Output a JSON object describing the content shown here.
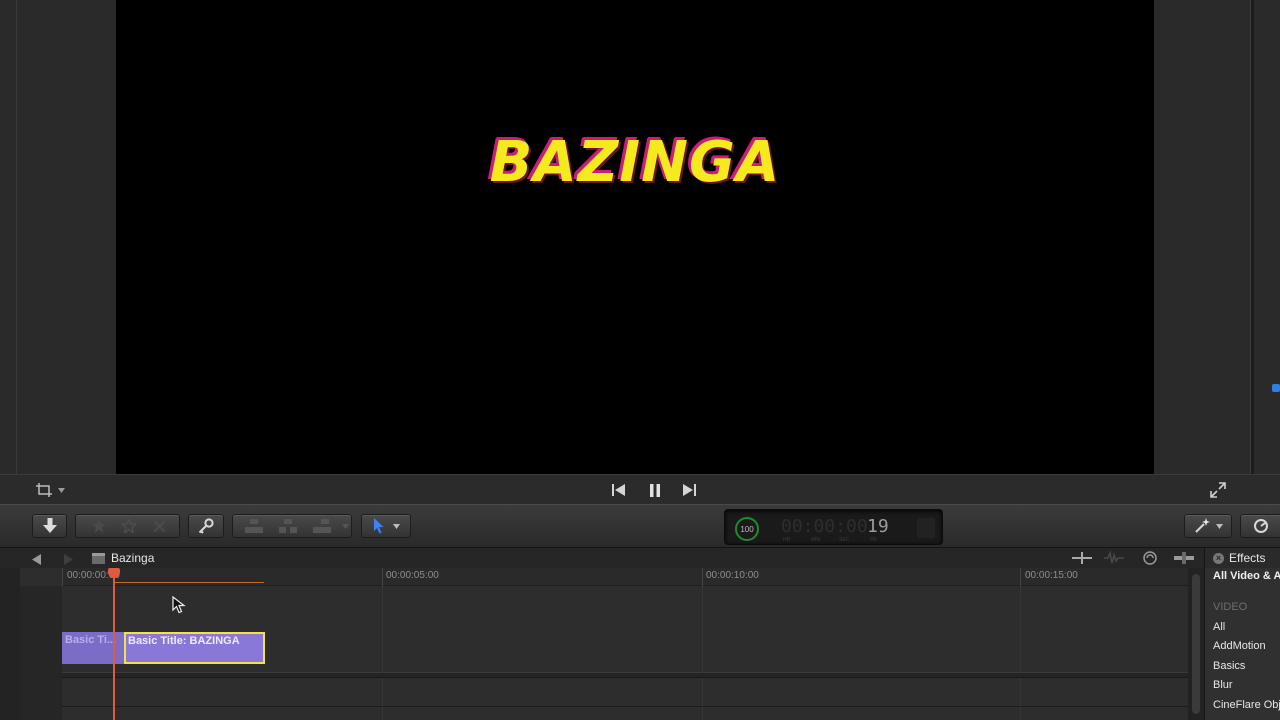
{
  "viewer": {
    "title_overlay": "BAZINGA"
  },
  "viewer_bar": {
    "crop_icon": "crop-icon",
    "transport": [
      "skip-back-icon",
      "pause-icon",
      "skip-forward-icon"
    ],
    "fullscreen_icon": "fullscreen-icon"
  },
  "toolbar": {
    "import_icon": "download-icon",
    "rating_icons": [
      "favorite-star-icon",
      "unrate-star-icon",
      "reject-icon"
    ],
    "keyword_icon": "key-icon",
    "edit_icons": [
      "connect-clip-icon",
      "insert-clip-icon",
      "append-clip-icon"
    ],
    "select_tool_icon": "arrow-pointer-icon",
    "timecode": {
      "percent": "100",
      "dim_digits": "00:00:00:",
      "frames": "19",
      "units": [
        "HR",
        "MIN",
        "SEC",
        "FR"
      ]
    },
    "enhance_icon": "magic-wand-icon",
    "retime_icon": "retime-icon"
  },
  "timeline": {
    "project_name": "Bazinga",
    "ruler": [
      "00:00:00:00",
      "00:00:05:00",
      "00:00:10:00",
      "00:00:15:00"
    ],
    "clips": [
      {
        "label": "Basic Ti..."
      },
      {
        "label": "Basic Title: BAZINGA"
      }
    ]
  },
  "effects": {
    "title": "Effects",
    "filter": "All Video & Au",
    "section": "VIDEO",
    "items": [
      "All",
      "AddMotion",
      "Basics",
      "Blur",
      "CineFlare Obj"
    ]
  },
  "colors": {
    "title_fill": "#f5ea1e",
    "title_outline": "#c81e78",
    "clip": "#8a78d8",
    "selected_clip_border": "#f2e24a",
    "playhead": "#e05a40",
    "timecode_gauge": "#1f8a2f",
    "select_tool": "#3b82f6"
  }
}
